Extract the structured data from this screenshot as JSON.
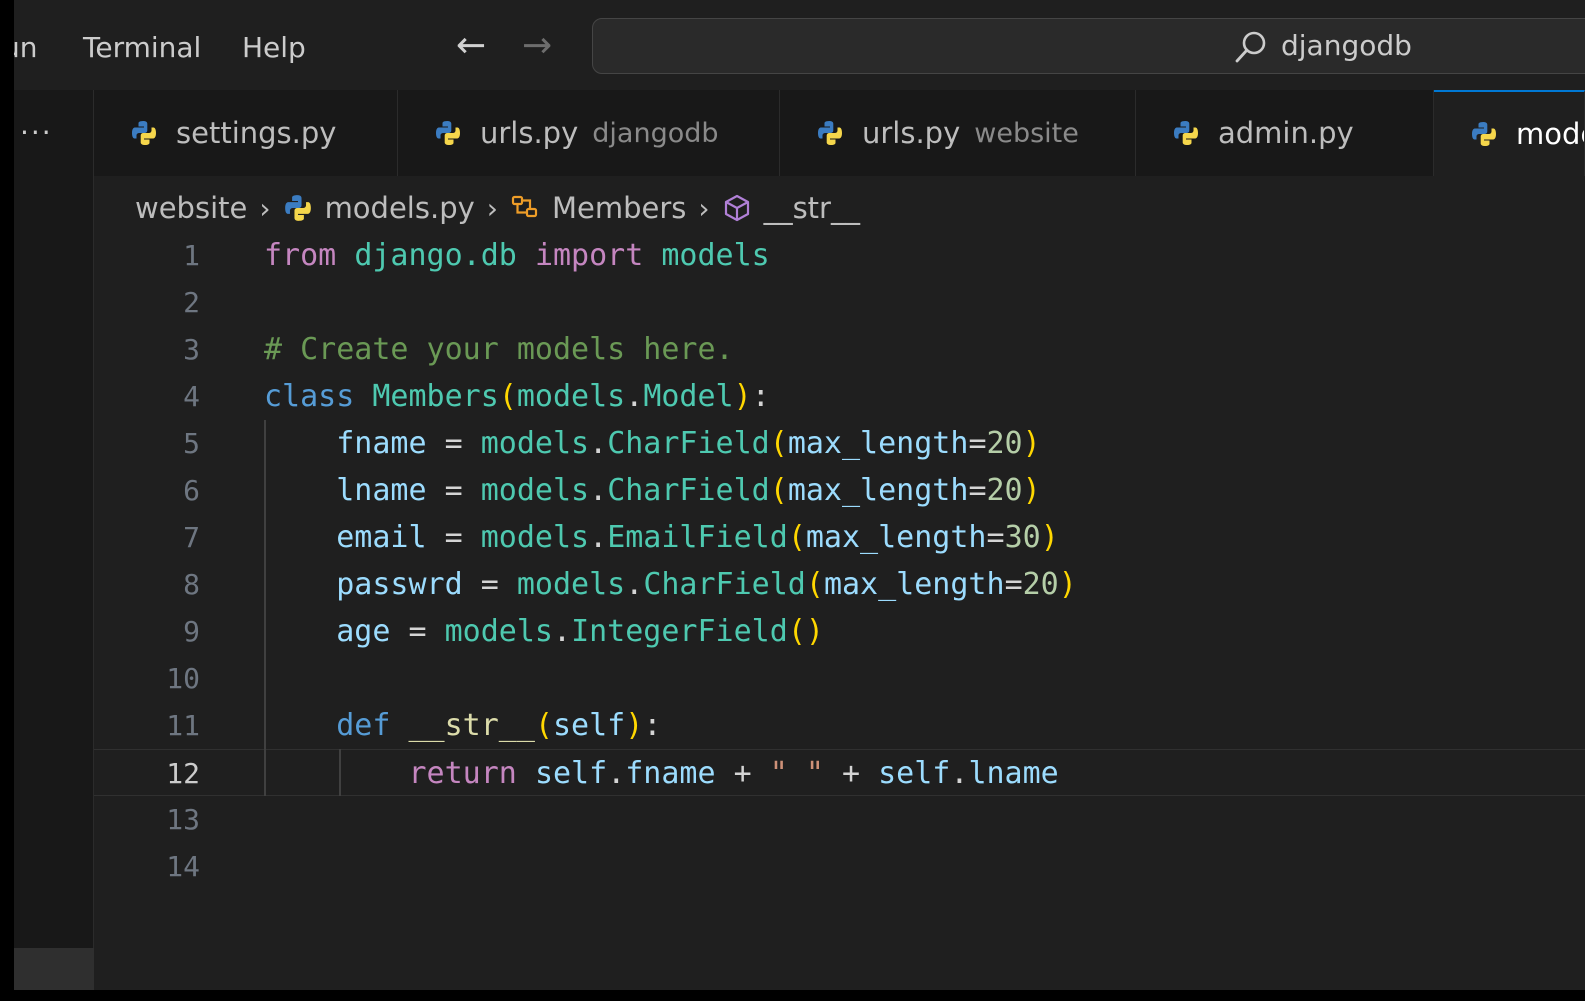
{
  "menu": {
    "run": "un",
    "terminal": "Terminal",
    "help": "Help"
  },
  "nav": {
    "back": "←",
    "forward": "→"
  },
  "command_center": {
    "text": "djangodb",
    "icon": "search-icon"
  },
  "sidebar": {
    "more": "···"
  },
  "tabs": [
    {
      "label": "settings.py",
      "description": ""
    },
    {
      "label": "urls.py",
      "description": "djangodb"
    },
    {
      "label": "urls.py",
      "description": "website"
    },
    {
      "label": "admin.py",
      "description": ""
    },
    {
      "label": "models.py",
      "description": "",
      "active": true
    }
  ],
  "breadcrumb": {
    "folder": "website",
    "file": "models.py",
    "class": "Members",
    "method": "__str__",
    "separator": "›"
  },
  "colors": {
    "python_blue": "#3b7cc1",
    "python_yellow": "#f5d64b",
    "accent": "#0078d4"
  },
  "code": {
    "current_line": 12,
    "line_numbers": [
      "1",
      "2",
      "3",
      "4",
      "5",
      "6",
      "7",
      "8",
      "9",
      "10",
      "11",
      "12",
      "13",
      "14"
    ],
    "lines": [
      [
        [
          "kw",
          "from"
        ],
        [
          "op",
          " "
        ],
        [
          "mod",
          "django.db"
        ],
        [
          "op",
          " "
        ],
        [
          "kw",
          "import"
        ],
        [
          "op",
          " "
        ],
        [
          "mod",
          "models"
        ]
      ],
      [],
      [
        [
          "cmt",
          "# Create your models here."
        ]
      ],
      [
        [
          "kwb",
          "class"
        ],
        [
          "op",
          " "
        ],
        [
          "cls",
          "Members"
        ],
        [
          "br1",
          "("
        ],
        [
          "mod",
          "models"
        ],
        [
          "op",
          "."
        ],
        [
          "cls",
          "Model"
        ],
        [
          "br1",
          ")"
        ],
        [
          "op",
          ":"
        ]
      ],
      [
        [
          "op",
          "    "
        ],
        [
          "var",
          "fname"
        ],
        [
          "op",
          " = "
        ],
        [
          "mod",
          "models"
        ],
        [
          "op",
          "."
        ],
        [
          "cls",
          "CharField"
        ],
        [
          "br1",
          "("
        ],
        [
          "var",
          "max_length"
        ],
        [
          "op",
          "="
        ],
        [
          "num",
          "20"
        ],
        [
          "br1",
          ")"
        ]
      ],
      [
        [
          "op",
          "    "
        ],
        [
          "var",
          "lname"
        ],
        [
          "op",
          " = "
        ],
        [
          "mod",
          "models"
        ],
        [
          "op",
          "."
        ],
        [
          "cls",
          "CharField"
        ],
        [
          "br1",
          "("
        ],
        [
          "var",
          "max_length"
        ],
        [
          "op",
          "="
        ],
        [
          "num",
          "20"
        ],
        [
          "br1",
          ")"
        ]
      ],
      [
        [
          "op",
          "    "
        ],
        [
          "var",
          "email"
        ],
        [
          "op",
          " = "
        ],
        [
          "mod",
          "models"
        ],
        [
          "op",
          "."
        ],
        [
          "cls",
          "EmailField"
        ],
        [
          "br1",
          "("
        ],
        [
          "var",
          "max_length"
        ],
        [
          "op",
          "="
        ],
        [
          "num",
          "30"
        ],
        [
          "br1",
          ")"
        ]
      ],
      [
        [
          "op",
          "    "
        ],
        [
          "var",
          "passwrd"
        ],
        [
          "op",
          " = "
        ],
        [
          "mod",
          "models"
        ],
        [
          "op",
          "."
        ],
        [
          "cls",
          "CharField"
        ],
        [
          "br1",
          "("
        ],
        [
          "var",
          "max_length"
        ],
        [
          "op",
          "="
        ],
        [
          "num",
          "20"
        ],
        [
          "br1",
          ")"
        ]
      ],
      [
        [
          "op",
          "    "
        ],
        [
          "var",
          "age"
        ],
        [
          "op",
          " = "
        ],
        [
          "mod",
          "models"
        ],
        [
          "op",
          "."
        ],
        [
          "cls",
          "IntegerField"
        ],
        [
          "br1",
          "()"
        ]
      ],
      [],
      [
        [
          "op",
          "    "
        ],
        [
          "kwb",
          "def"
        ],
        [
          "op",
          " "
        ],
        [
          "fn",
          "__str__"
        ],
        [
          "br1",
          "("
        ],
        [
          "var",
          "self"
        ],
        [
          "br1",
          ")"
        ],
        [
          "op",
          ":"
        ]
      ],
      [
        [
          "op",
          "        "
        ],
        [
          "kw",
          "return"
        ],
        [
          "op",
          " "
        ],
        [
          "var",
          "self"
        ],
        [
          "op",
          "."
        ],
        [
          "var",
          "fname"
        ],
        [
          "op",
          " + "
        ],
        [
          "str",
          "\" \""
        ],
        [
          "op",
          " + "
        ],
        [
          "var",
          "self"
        ],
        [
          "op",
          "."
        ],
        [
          "var",
          "lname"
        ]
      ],
      [],
      []
    ]
  }
}
